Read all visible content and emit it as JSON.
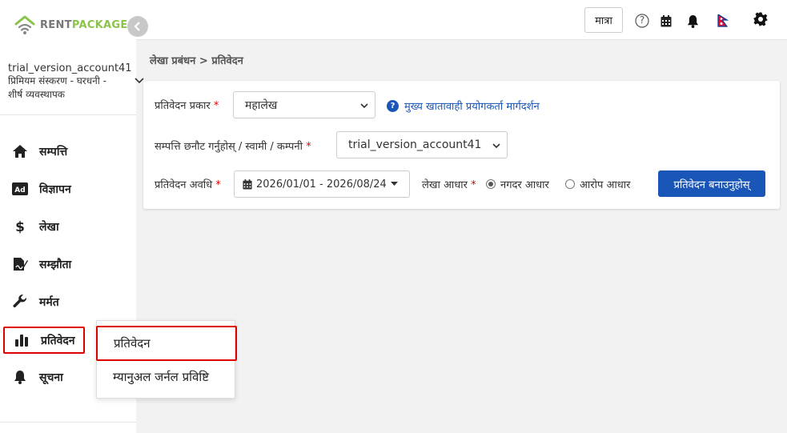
{
  "brand": {
    "rent": "RENT",
    "package": "PACKAGE"
  },
  "account": {
    "name": "trial_version_account41",
    "plan": "प्रिमियम संस्करण - घरधनी - शीर्ष व्यवस्थापक"
  },
  "sidebar": {
    "items": [
      {
        "label": "सम्पत्ति",
        "icon": "home-icon"
      },
      {
        "label": "विज्ञापन",
        "icon": "ad-icon"
      },
      {
        "label": "लेखा",
        "icon": "dollar-icon"
      },
      {
        "label": "सम्झौता",
        "icon": "signature-icon"
      },
      {
        "label": "मर्मत",
        "icon": "wrench-icon"
      },
      {
        "label": "प्रतिवेदन",
        "icon": "bar-chart-icon"
      },
      {
        "label": "सूचना",
        "icon": "bell-icon"
      }
    ]
  },
  "submenu": {
    "items": [
      {
        "label": "प्रतिवेदन"
      },
      {
        "label": "म्यानुअल जर्नल प्रविष्टि"
      }
    ]
  },
  "topbar": {
    "unit_label": "मात्रा",
    "help_glyph": "?"
  },
  "breadcrumb": "लेखा प्रबंधन > प्रतिवेदन",
  "form": {
    "report_type_label": "प्रतिवेदन प्रकार",
    "report_type_value": "महालेख",
    "help_link": "मुख्य खातावाही प्रयोगकर्ता मार्गदर्शन",
    "property_label": "सम्पत्ति छनौट गर्नुहोस् / स्वामी / कम्पनी",
    "property_value": "trial_version_account41",
    "period_label": "प्रतिवेदन अवधि",
    "period_value": "2026/01/01 - 2026/08/24",
    "basis_label": "लेखा आधार",
    "basis_options": [
      {
        "label": "नगदर आधार",
        "selected": true
      },
      {
        "label": "आरोप आधार",
        "selected": false
      }
    ],
    "generate_label": "प्रतिवेदन बनाउनुहोस्",
    "required_mark": "*"
  },
  "colors": {
    "accent": "#1a56b8",
    "brand_green": "#8cc34a",
    "highlight": "#dd0000"
  }
}
